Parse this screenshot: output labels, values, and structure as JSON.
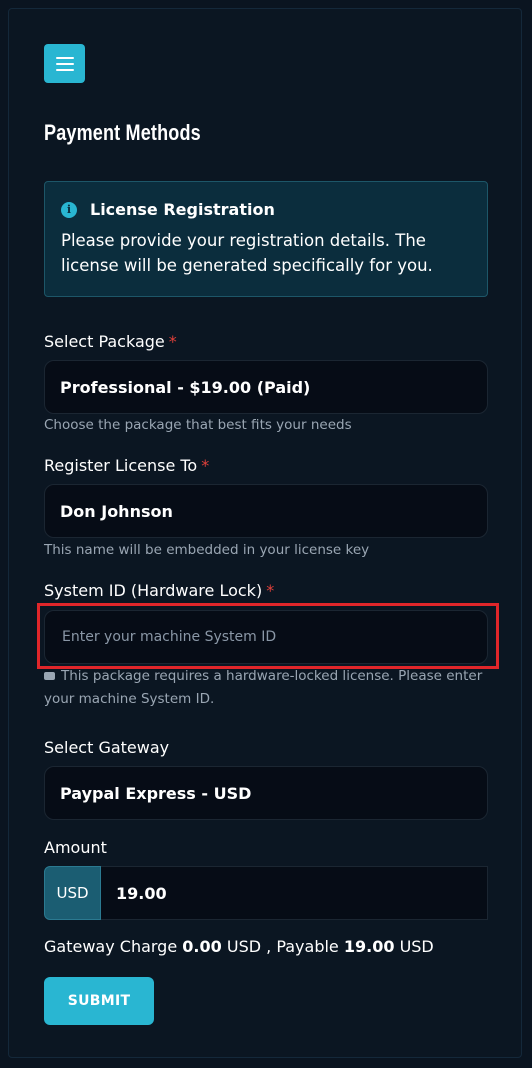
{
  "header": {
    "title": "Payment Methods",
    "menu_icon": "hamburger-icon"
  },
  "info": {
    "icon": "info-icon",
    "title": "License Registration",
    "text": "Please provide your registration details. The license will be generated specifically for you."
  },
  "package": {
    "label": "Select Package",
    "required": "*",
    "value": "Professional - $19.00 (Paid)",
    "help": "Choose the package that best fits your needs"
  },
  "license_to": {
    "label": "Register License To",
    "required": "*",
    "value": "Don Johnson",
    "help": "This name will be embedded in your license key"
  },
  "system_id": {
    "label": "System ID (Hardware Lock)",
    "required": "*",
    "placeholder": "Enter your machine System ID",
    "value": "",
    "help": "This package requires a hardware-locked license. Please enter your machine System ID."
  },
  "gateway": {
    "label": "Select Gateway",
    "value": "Paypal Express - USD"
  },
  "amount": {
    "label": "Amount",
    "currency": "USD",
    "value": "19.00"
  },
  "charge": {
    "prefix": "Gateway Charge",
    "charge_value": "0.00",
    "charge_currency": "USD",
    "separator": ", Payable",
    "payable_value": "19.00",
    "payable_currency": "USD"
  },
  "submit_label": "SUBMIT",
  "colors": {
    "accent": "#29b6d2",
    "required": "#e0403a",
    "highlight": "#e0262a"
  }
}
